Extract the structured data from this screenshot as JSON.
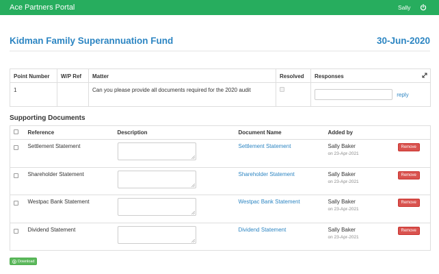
{
  "header": {
    "brand": "Ace Partners Portal",
    "user": "Sally",
    "power_icon": "power-icon",
    "bar_color": "#27ad5e"
  },
  "fund": {
    "title": "Kidman Family Superannuation Fund",
    "date": "30-Jun-2020",
    "accent_color": "#2c85c2"
  },
  "matter_table": {
    "columns": [
      "Point Number",
      "W/P Ref",
      "Matter",
      "Resolved",
      "Responses"
    ],
    "expand_icon": "expand-icon",
    "rows": [
      {
        "point_number": "1",
        "wp_ref": "",
        "matter": "Can you please provide all documents required for the 2020 audit",
        "resolved": false,
        "response_value": "",
        "reply_label": "reply"
      }
    ]
  },
  "supporting_documents": {
    "heading": "Supporting Documents",
    "columns": [
      "Reference",
      "Description",
      "Document Name",
      "Added by"
    ],
    "remove_label": "Remove",
    "rows": [
      {
        "reference": "Settlement Statement",
        "description": "",
        "document_name": "Settlement Statement",
        "added_by": "Sally Baker",
        "added_on": "on 23-Apr-2021"
      },
      {
        "reference": "Shareholder Statement",
        "description": "",
        "document_name": "Shareholder Statement",
        "added_by": "Sally Baker",
        "added_on": "on 23-Apr-2021"
      },
      {
        "reference": "Westpac Bank Statement",
        "description": "",
        "document_name": "Westpac Bank Statement",
        "added_by": "Sally Baker",
        "added_on": "on 23-Apr-2021"
      },
      {
        "reference": "Dividend Statement",
        "description": "",
        "document_name": "Dividend Statement",
        "added_by": "Sally Baker",
        "added_on": "on 23-Apr-2021"
      }
    ]
  },
  "download": {
    "label": "Download",
    "icon": "download-circle-icon",
    "color": "#5cb85c"
  }
}
